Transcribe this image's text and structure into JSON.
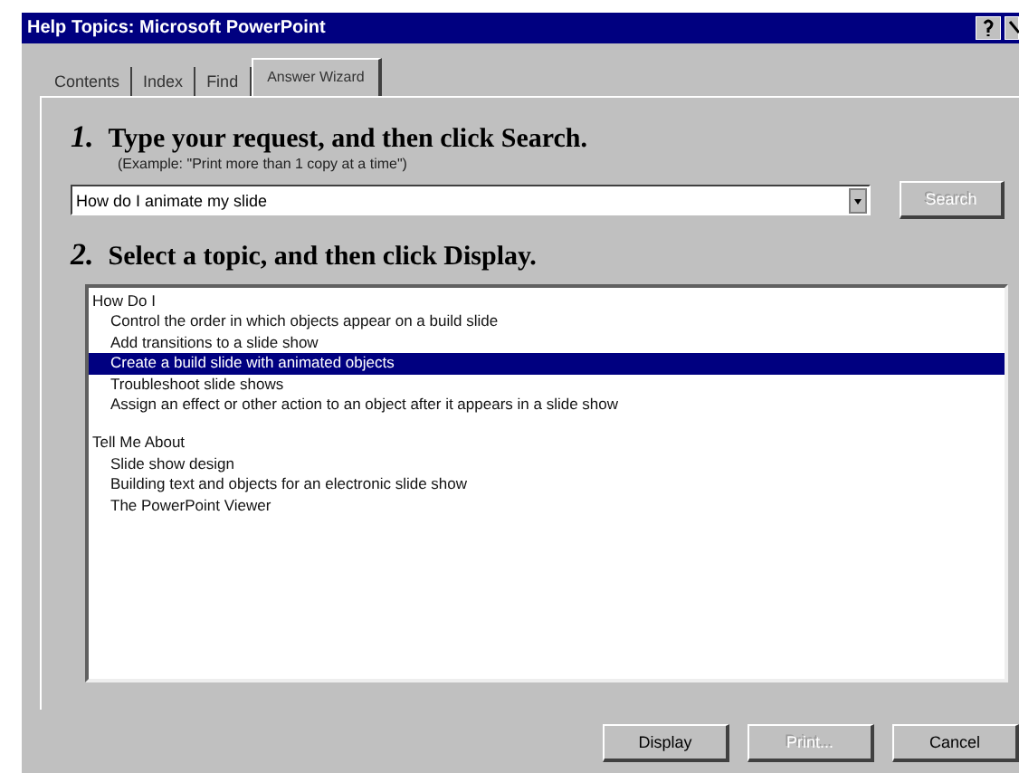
{
  "window": {
    "title": "Help Topics: Microsoft PowerPoint"
  },
  "tabs": [
    {
      "label": "Contents",
      "selected": false
    },
    {
      "label": "Index",
      "selected": false
    },
    {
      "label": "Find",
      "selected": false
    },
    {
      "label": "Answer Wizard",
      "selected": true
    }
  ],
  "step1": {
    "number": "1.",
    "heading": "Type your request, and then click Search.",
    "example": "(Example: \"Print more than 1 copy at a time\")"
  },
  "request": {
    "value": "How do I animate my slide"
  },
  "search_button": {
    "label": "Search",
    "disabled": true
  },
  "step2": {
    "number": "2.",
    "heading": "Select a topic, and then click Display."
  },
  "topics": [
    {
      "label": "How Do I",
      "selected": false,
      "children": [
        {
          "label": "Control the order in which objects appear on a build slide",
          "selected": false
        },
        {
          "label": "Add transitions to a slide show",
          "selected": false
        },
        {
          "label": "Create a build slide with animated objects",
          "selected": true
        },
        {
          "label": "Troubleshoot slide shows",
          "selected": false
        },
        {
          "label": "Assign an effect or other action to an object after it appears in a slide show",
          "selected": false
        }
      ]
    },
    {
      "label": "Tell Me About",
      "selected": false,
      "children": [
        {
          "label": "Slide show design",
          "selected": false
        },
        {
          "label": "Building text and objects for an electronic slide show",
          "selected": false
        },
        {
          "label": "The PowerPoint Viewer",
          "selected": false
        }
      ]
    }
  ],
  "buttons": [
    {
      "label": "Display",
      "disabled": false
    },
    {
      "label": "Print...",
      "disabled": true
    },
    {
      "label": "Cancel",
      "disabled": false
    }
  ]
}
